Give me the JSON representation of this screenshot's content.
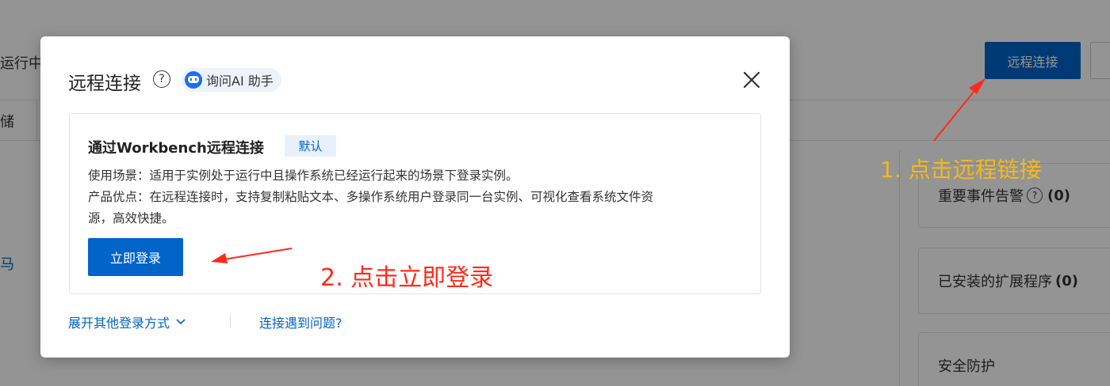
{
  "background": {
    "status_partial": "运行中",
    "remote_connect_button": "远程连接",
    "tab_partial": "储",
    "left_link_partial": "马",
    "cards": [
      {
        "label": "重要事件告警",
        "count": "(0)",
        "has_help": true
      },
      {
        "label": "已安装的扩展程序",
        "count": "(0)",
        "has_help": false
      },
      {
        "label": "安全防护",
        "count": "",
        "has_help": false
      }
    ]
  },
  "modal": {
    "title": "远程连接",
    "ai_assistant": "询问AI 助手",
    "option": {
      "title": "通过Workbench远程连接",
      "badge": "默认",
      "scenario": "使用场景：适用于实例处于运行中且操作系统已经运行起来的场景下登录实例。",
      "advantage_line1": "产品优点：在远程连接时，支持复制粘贴文本、多操作系统用户登录同一台实例、可视化查看系统文件资",
      "advantage_line2": "源，高效快捷。",
      "login_button": "立即登录"
    },
    "more_login_methods": "展开其他登录方式",
    "connection_problem": "连接遇到问题?"
  },
  "annotations": {
    "step1": "1. 点击远程链接",
    "step2": "2. 点击立即登录",
    "step1_color": "#f5b819",
    "step2_color": "#ff2a1a"
  },
  "colors": {
    "primary": "#0064c8",
    "overlay": "rgba(0,0,0,0.42)"
  }
}
